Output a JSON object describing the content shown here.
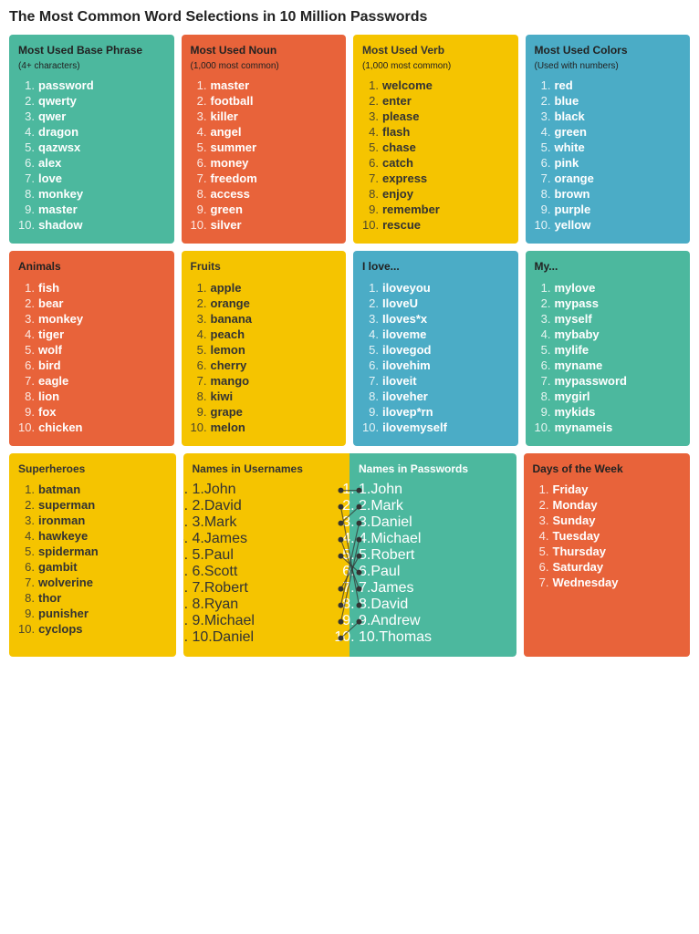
{
  "title": "The Most Common Word Selections in 10 Million Passwords",
  "sections": {
    "base_phrase": {
      "title": "Most Used Base Phrase",
      "subtitle": "(4+ characters)",
      "color": "green",
      "items": [
        "password",
        "qwerty",
        "qwer",
        "dragon",
        "qazwsx",
        "alex",
        "love",
        "monkey",
        "master",
        "shadow"
      ]
    },
    "noun": {
      "title": "Most Used Noun",
      "subtitle": "(1,000 most common)",
      "color": "orange",
      "items": [
        "master",
        "football",
        "killer",
        "angel",
        "summer",
        "money",
        "freedom",
        "access",
        "green",
        "silver"
      ]
    },
    "verb": {
      "title": "Most Used Verb",
      "subtitle": "(1,000 most common)",
      "color": "yellow",
      "items": [
        "welcome",
        "enter",
        "please",
        "flash",
        "chase",
        "catch",
        "express",
        "enjoy",
        "remember",
        "rescue"
      ]
    },
    "colors": {
      "title": "Most Used Colors",
      "subtitle": "(Used with numbers)",
      "color": "blue",
      "items": [
        "red",
        "blue",
        "black",
        "green",
        "white",
        "pink",
        "orange",
        "brown",
        "purple",
        "yellow"
      ]
    },
    "animals": {
      "title": "Animals",
      "color": "red",
      "items": [
        "fish",
        "bear",
        "monkey",
        "tiger",
        "wolf",
        "bird",
        "eagle",
        "lion",
        "fox",
        "chicken"
      ]
    },
    "fruits": {
      "title": "Fruits",
      "color": "yellow",
      "items": [
        "apple",
        "orange",
        "banana",
        "peach",
        "lemon",
        "cherry",
        "mango",
        "kiwi",
        "grape",
        "melon"
      ]
    },
    "ilove": {
      "title": "I love...",
      "color": "blue",
      "items": [
        "iloveyou",
        "IloveU",
        "Iloves*x",
        "iloveme",
        "ilovegod",
        "ilovehim",
        "iloveit",
        "iloveher",
        "ilovep*rn",
        "ilovemyself"
      ]
    },
    "my": {
      "title": "My...",
      "color": "green",
      "items": [
        "mylove",
        "mypass",
        "myself",
        "mybaby",
        "mylife",
        "myname",
        "mypassword",
        "mygirl",
        "mykids",
        "mynameis"
      ]
    },
    "superheroes": {
      "title": "Superheroes",
      "color": "yellow",
      "items": [
        "batman",
        "superman",
        "ironman",
        "hawkeye",
        "spiderman",
        "gambit",
        "wolverine",
        "thor",
        "punisher",
        "cyclops"
      ]
    },
    "names_usernames": {
      "title": "Names in Usernames",
      "items": [
        "John",
        "David",
        "Mark",
        "James",
        "Paul",
        "Scott",
        "Robert",
        "Ryan",
        "Michael",
        "Daniel"
      ]
    },
    "names_passwords": {
      "title": "Names in Passwords",
      "items": [
        "John",
        "Mark",
        "Daniel",
        "Michael",
        "Robert",
        "Paul",
        "James",
        "David",
        "Andrew",
        "Thomas"
      ]
    },
    "days": {
      "title": "Days of the Week",
      "color": "red",
      "items": [
        "Friday",
        "Monday",
        "Sunday",
        "Tuesday",
        "Thursday",
        "Saturday",
        "Wednesday"
      ]
    }
  },
  "connectors": [
    {
      "from": 0,
      "to": 0
    },
    {
      "from": 1,
      "to": 7
    },
    {
      "from": 2,
      "to": 1
    },
    {
      "from": 3,
      "to": 6
    },
    {
      "from": 4,
      "to": 4
    },
    {
      "from": 6,
      "to": 5
    },
    {
      "from": 7,
      "to": 3
    },
    {
      "from": 8,
      "to": 2
    },
    {
      "from": 9,
      "to": 8
    }
  ]
}
